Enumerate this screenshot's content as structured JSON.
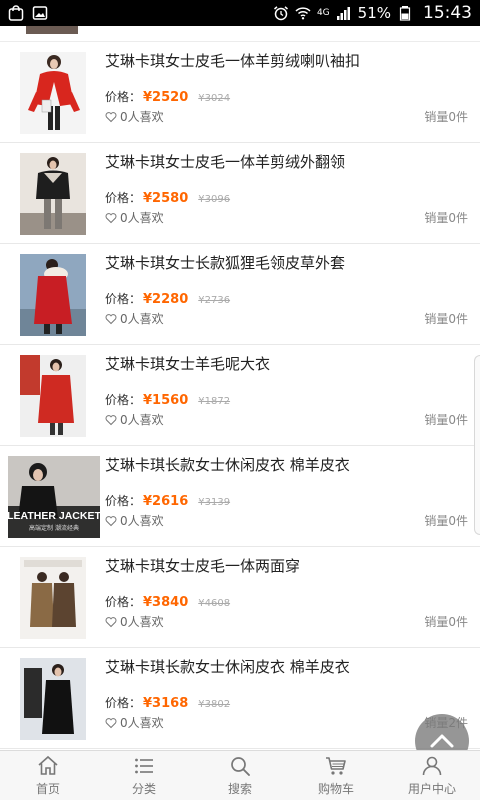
{
  "status_bar": {
    "network": "4G",
    "battery": "51%",
    "time": "15:43",
    "icons": [
      "bag-icon",
      "image-icon",
      "alarm-icon",
      "wifi-icon",
      "signal-icon",
      "battery-icon"
    ]
  },
  "products": [
    {
      "title": "艾琳卡琪女士皮毛一体羊剪绒喇叭袖扣",
      "price_label": "价格：",
      "price": "¥2520",
      "orig": "¥3024",
      "likes": "0人喜欢",
      "sales": "销量0件"
    },
    {
      "title": "艾琳卡琪女士皮毛一体羊剪绒外翻领",
      "price_label": "价格：",
      "price": "¥2580",
      "orig": "¥3096",
      "likes": "0人喜欢",
      "sales": "销量0件"
    },
    {
      "title": "艾琳卡琪女士长款狐狸毛领皮草外套",
      "price_label": "价格：",
      "price": "¥2280",
      "orig": "¥2736",
      "likes": "0人喜欢",
      "sales": "销量0件"
    },
    {
      "title": "艾琳卡琪女士羊毛呢大衣",
      "price_label": "价格：",
      "price": "¥1560",
      "orig": "¥1872",
      "likes": "0人喜欢",
      "sales": "销量0件"
    },
    {
      "title": "艾琳卡琪长款女士休闲皮衣 棉羊皮衣",
      "price_label": "价格：",
      "price": "¥2616",
      "orig": "¥3139",
      "likes": "0人喜欢",
      "sales": "销量0件",
      "thumb_text": "LEATHER JACKET",
      "thumb_subtext": "高端定制 潮流经典"
    },
    {
      "title": "艾琳卡琪女士皮毛一体两面穿",
      "price_label": "价格：",
      "price": "¥3840",
      "orig": "¥4608",
      "likes": "0人喜欢",
      "sales": "销量0件"
    },
    {
      "title": "艾琳卡琪长款女士休闲皮衣 棉羊皮衣",
      "price_label": "价格：",
      "price": "¥3168",
      "orig": "¥3802",
      "likes": "0人喜欢",
      "sales": "销量2件"
    }
  ],
  "nav": [
    {
      "label": "首页",
      "icon": "home-icon"
    },
    {
      "label": "分类",
      "icon": "list-icon"
    },
    {
      "label": "搜索",
      "icon": "search-icon"
    },
    {
      "label": "购物车",
      "icon": "cart-icon"
    },
    {
      "label": "用户中心",
      "icon": "user-icon"
    }
  ],
  "colors": {
    "price": "#ff6600",
    "nav_text": "#777777",
    "status_bar": "#000000"
  }
}
